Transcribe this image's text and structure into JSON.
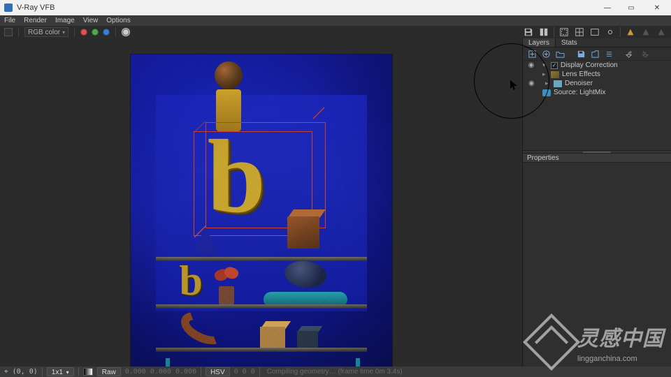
{
  "titlebar": {
    "title": "V-Ray VFB"
  },
  "window_controls": {
    "minimize": "—",
    "maximize": "▭",
    "close": "✕"
  },
  "menu": {
    "file": "File",
    "render": "Render",
    "image": "Image",
    "view": "View",
    "options": "Options"
  },
  "toolbar": {
    "channel_label": "RGB color",
    "channel_arrow": "▾"
  },
  "right_icons": {
    "save": "save",
    "compare": "compare",
    "render_region": "region",
    "panorama": "pano",
    "link": "link",
    "lightmix": "lightmix",
    "history_a": "histA",
    "history_b": "histB"
  },
  "panel": {
    "tabs": {
      "layers": "Layers",
      "stats": "Stats"
    },
    "tool_tips": {
      "add_cc": "add-cc",
      "create_cc": "create-cc",
      "folder": "folder",
      "save": "save",
      "load": "load",
      "reset": "reset",
      "undo": "undo",
      "redo": "redo"
    },
    "layers": {
      "display_correction": "Display Correction",
      "lens_effects": "Lens Effects",
      "denoiser": "Denoiser",
      "source_lightmix": "Source: LightMix"
    },
    "properties": "Properties"
  },
  "status": {
    "coords_icon": "⌖",
    "coords": "(0, 0)",
    "ratio": "1x1",
    "arrow": "▾",
    "raw": "Raw",
    "raw_vals": "0.000  0.000  0.000",
    "mode": "HSV",
    "mode_vals": "0      0      0",
    "message": "Compiling geometry… (frame time  0m  3.4s)",
    "render_letter_b": "b"
  },
  "watermark": {
    "text": "灵感中国",
    "domain": "lingganchina.com"
  }
}
